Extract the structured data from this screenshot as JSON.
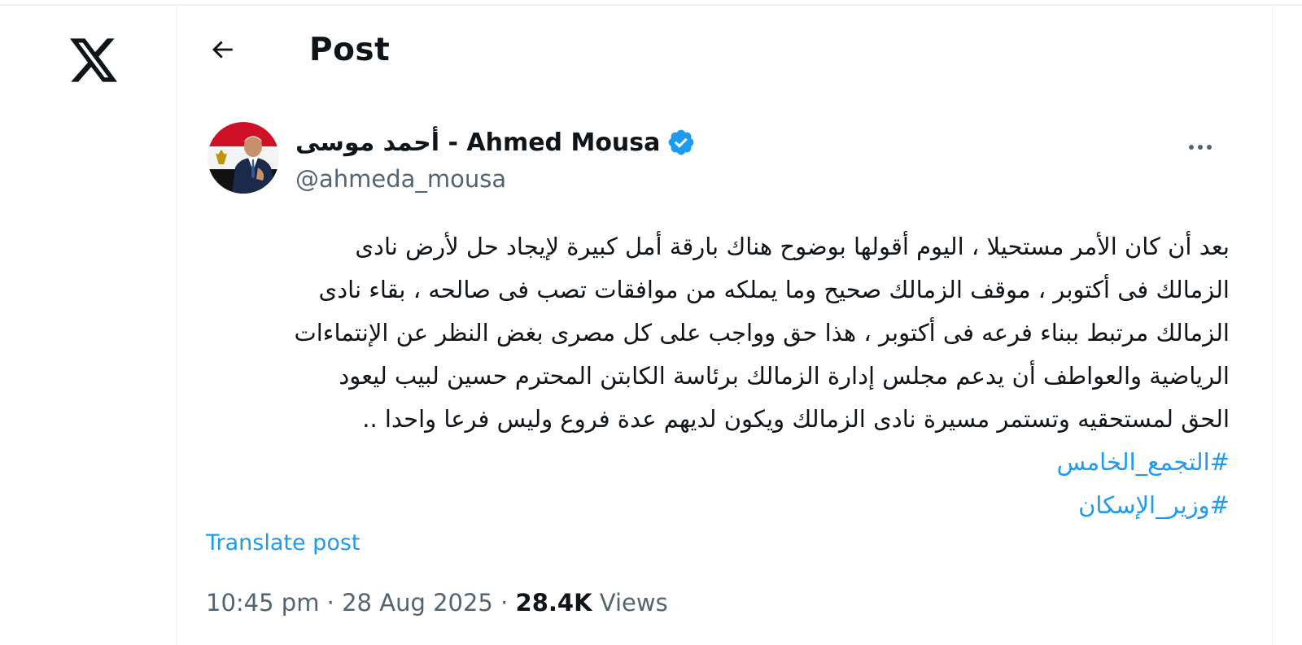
{
  "nav": {
    "logo_icon": "x-logo-icon",
    "back_icon": "arrow-left-icon"
  },
  "header": {
    "title": "Post"
  },
  "author": {
    "display_name": "أحمد موسى - Ahmed Mousa",
    "handle": "@ahmeda_mousa",
    "verified": true,
    "verified_color": "#1d9bf0",
    "avatar_icon": "profile-avatar"
  },
  "post": {
    "lines": [
      "بعد أن كان الأمر مستحيلا ، اليوم أقولها بوضوح هناك بارقة أمل كبيرة لإيجاد حل لأرض نادى",
      "الزمالك فى أكتوبر ، موقف الزمالك صحيح وما يملكه من موافقات تصب فى صالحه ، بقاء نادى",
      "الزمالك مرتبط ببناء فرعه فى أكتوبر ، هذا حق وواجب على كل مصرى بغض النظر عن الإنتماءات",
      "الرياضية والعواطف أن يدعم مجلس إدارة الزمالك برئاسة الكابتن المحترم حسين لبيب ليعود",
      "الحق لمستحقيه وتستمر مسيرة نادى الزمالك  ويكون لديهم عدة فروع وليس فرعا واحدا .."
    ],
    "hashtags": [
      "#التجمع_الخامس",
      "#وزير_الإسكان"
    ],
    "translate_label": "Translate post",
    "time": "10:45 pm",
    "date": "28 Aug 2025",
    "separator": "·",
    "views_count": "28.4K",
    "views_label": "Views"
  },
  "colors": {
    "accent": "#1d9bf0",
    "text_primary": "#0f1419",
    "text_secondary": "#536471",
    "border": "#eff3f4"
  }
}
